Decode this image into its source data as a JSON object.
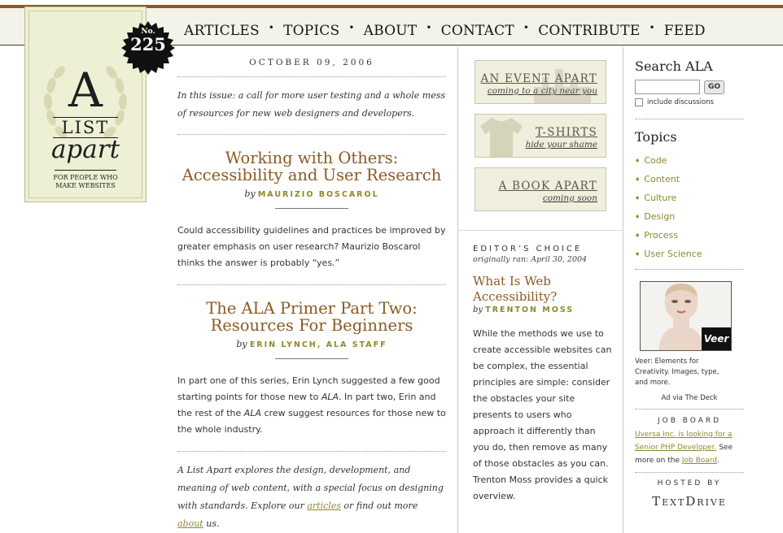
{
  "nav": [
    "ARTICLES",
    "TOPICS",
    "ABOUT",
    "CONTACT",
    "CONTRIBUTE",
    "FEED"
  ],
  "nav_separator": "•",
  "logo": {
    "letter": "A",
    "list": "LIST",
    "apart": "apart",
    "tagline_1": "FOR PEOPLE WHO",
    "tagline_2": "MAKE WEBSITES"
  },
  "badge": {
    "no": "No.",
    "number": "225"
  },
  "issue": {
    "date": "OCTOBER 09, 2006",
    "intro": "In this issue: a call for more user testing and a whole mess of resources for new web designers and developers."
  },
  "articles": [
    {
      "title": "Working with Others: Accessibility and User Research",
      "by": "by",
      "author": "MAURIZIO BOSCAROL",
      "description": "Could accessibility guidelines and practices be improved by greater emphasis on user research? Maurizio Boscarol thinks the answer is probably “yes.”"
    },
    {
      "title": "The ALA Primer Part Two: Resources For Beginners",
      "by": "by",
      "author": "ERIN LYNCH, ALA STAFF",
      "description_parts": [
        "In part one of this series, Erin Lynch suggested a few good starting points for those new to ",
        "ALA",
        ". In part two, Erin and the rest of the ",
        "ALA",
        " crew suggest resources for those new to the whole industry."
      ]
    }
  ],
  "footer_note": {
    "before": "A List Apart explores the design, development, and meaning of web content, with a special focus on designing with standards. Explore our ",
    "link1": "articles",
    "middle": " or find out more ",
    "link2": "about",
    "after": " us."
  },
  "promos": [
    {
      "big": "AN EVENT APART",
      "small": "coming to a city near you"
    },
    {
      "big": "T-SHIRTS",
      "small": "hide your shame"
    },
    {
      "big": "A BOOK APART",
      "small": "coming soon"
    }
  ],
  "editors_choice": {
    "label": "EDITOR’S CHOICE",
    "sub": "originally ran: April 30, 2004",
    "title": "What Is Web Accessibility?",
    "by": "by",
    "author": "TRENTON MOSS",
    "description": "While the methods we use to create accessible websites can be complex, the essential principles are simple: consider the obstacles your site presents to users who approach it differently than you do, then remove as many of those obstacles as you can. Trenton Moss provides a quick overview."
  },
  "search": {
    "heading": "Search ALA",
    "value": "",
    "go": "GO",
    "include": "include discussions"
  },
  "topics": {
    "heading": "Topics",
    "items": [
      "Code",
      "Content",
      "Culture",
      "Design",
      "Process",
      "User Science"
    ],
    "bullet": "♦"
  },
  "ad": {
    "brand": "Veer",
    "copy": "Veer: Elements for Creativity. Images, type, and more.",
    "via": "Ad via The Deck"
  },
  "job_board": {
    "heading": "JOB BOARD",
    "link": "Uversa Inc. is looking for a Senior PHP Developer.",
    "text_mid": " See more on the ",
    "link2": "Job Board",
    "text_end": "."
  },
  "hosted": {
    "label": "HOSTED BY",
    "name": "TextDrive"
  },
  "colors": {
    "accent_brown": "#8b5a22",
    "accent_olive": "#8e8a2b",
    "top_rule": "#8a5a2b",
    "nav_bg": "#f4f3ea"
  }
}
